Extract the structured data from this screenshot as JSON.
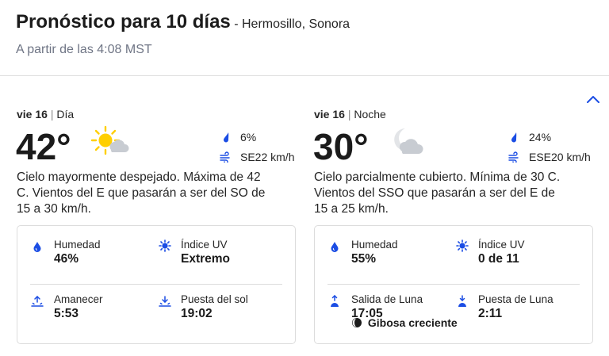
{
  "header": {
    "title": "Pronóstico para 10 días",
    "location": "- Hermosillo, Sonora",
    "as_of": "A partir de las 4:08 MST"
  },
  "day": {
    "date": "vie 16",
    "separator": "|",
    "period": "Día",
    "temperature": "42°",
    "icon": "mostly-sunny-icon",
    "precip": "6%",
    "wind": "SE22 km/h",
    "narrative": "Cielo mayormente despejado. Máxima de 42 C. Vientos del E que pasarán a ser del SO de 15 a 30 km/h.",
    "details": {
      "humidity_label": "Humedad",
      "humidity_value": "46%",
      "uv_label": "Índice UV",
      "uv_value": "Extremo",
      "sunrise_label": "Amanecer",
      "sunrise_value": "5:53",
      "sunset_label": "Puesta del sol",
      "sunset_value": "19:02"
    }
  },
  "night": {
    "date": "vie 16",
    "separator": "|",
    "period": "Noche",
    "temperature": "30°",
    "icon": "partly-cloudy-night-icon",
    "precip": "24%",
    "wind": "ESE20 km/h",
    "narrative": "Cielo parcialmente cubierto. Mínima de 30 C. Vientos del SSO que pasarán a ser del E de 15 a 25 km/h.",
    "details": {
      "humidity_label": "Humedad",
      "humidity_value": "55%",
      "uv_label": "Índice UV",
      "uv_value": "0 de 11",
      "moonrise_label": "Salida de Luna",
      "moonrise_value": "17:05",
      "moonset_label": "Puesta de Luna",
      "moonset_value": "2:11",
      "moon_phase": "Gibosa creciente"
    }
  },
  "colors": {
    "accent": "#1b4de4",
    "text": "#252525",
    "muted": "#6f7585",
    "border": "#dcdcdc",
    "sun": "#ffcf00"
  }
}
